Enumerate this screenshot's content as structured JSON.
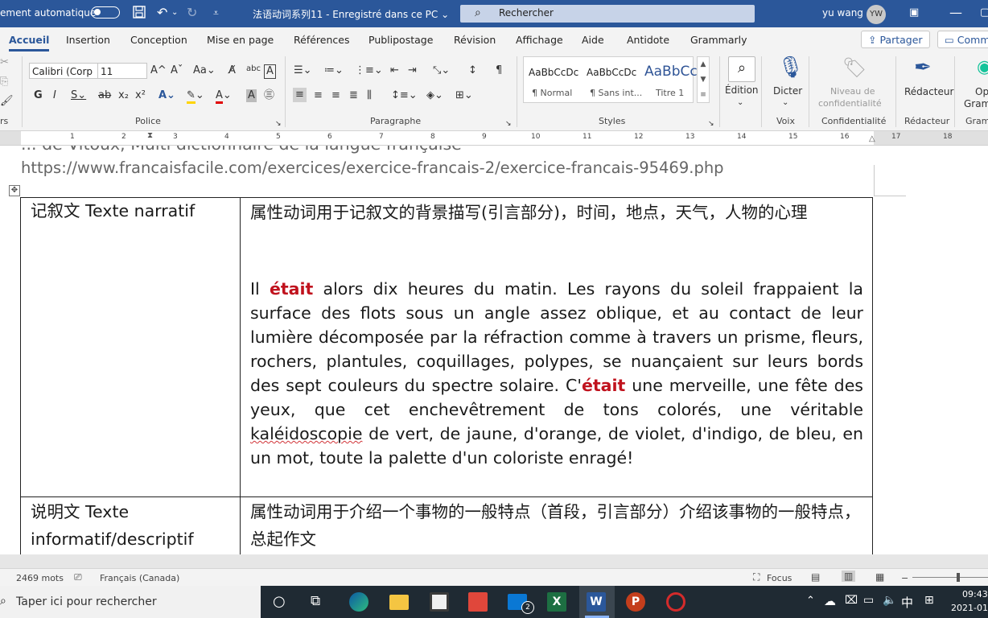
{
  "titlebar": {
    "autosave_label": "ement automatique",
    "document_title": "法语动词系列11  -  Enregistré dans ce PC  ⌄",
    "search_placeholder": "Rechercher",
    "user_name": "yu wang",
    "user_initials": "YW"
  },
  "menu": {
    "tabs": [
      "Accueil",
      "Insertion",
      "Conception",
      "Mise en page",
      "Références",
      "Publipostage",
      "Révision",
      "Affichage",
      "Aide",
      "Antidote",
      "Grammarly"
    ],
    "share_label": "Partager",
    "comments_label": "Comm"
  },
  "ribbon": {
    "font_name": "Calibri (Corp",
    "font_size": "11",
    "groups": {
      "clipboard": "rs",
      "police": "Police",
      "paragraphe": "Paragraphe",
      "styles": "Styles",
      "voix": "Voix",
      "confidentialite": "Confidentialité",
      "redacteur": "Rédacteur",
      "grammarly": "Gram"
    },
    "styles": [
      {
        "preview": "AaBbCcDc",
        "name": "¶ Normal"
      },
      {
        "preview": "AaBbCcDc",
        "name": "¶ Sans int..."
      },
      {
        "preview": "AaBbCc",
        "name": "Titre 1"
      }
    ],
    "edition_label": "Édition",
    "dicter_label": "Dicter",
    "niveau_label": "Niveau de",
    "confidentialite_label": "confidentialité",
    "redacteur_label": "Rédacteur",
    "grammarly_label_1": "Op",
    "grammarly_label_2": "Gram"
  },
  "ruler": {
    "numbers": [
      "1",
      "2",
      "3",
      "4",
      "5",
      "6",
      "7",
      "8",
      "9",
      "10",
      "11",
      "12",
      "13",
      "14",
      "15",
      "16",
      "17",
      "18"
    ]
  },
  "document": {
    "cut_line": "... de Vitoux, Multi dictionnaire de la langue française",
    "url_line": "https://www.francaisfacile.com/exercices/exercice-francais-2/exercice-francais-95469.php",
    "rows": [
      {
        "left": "记叙文 Texte narratif",
        "right_intro": "属性动词用于记叙文的背景描写(引言部分)，时间，地点，天气，人物的心理",
        "para": {
          "p1": "Il ",
          "r1": "était",
          "p2": " alors dix heures du matin. Les rayons du soleil frappaient la surface des flots sous un angle assez oblique, et au contact de leur lumière décomposée par la réfraction comme à travers un prisme, fleurs, rochers, plantules, coquillages, polypes, se nuançaient sur leurs bords des sept couleurs du spectre solaire. C'",
          "r2": "était",
          "p3": " une merveille, une fête des yeux, que cet enchevêtrement de tons colorés, une véritable ",
          "sq": "kaléidoscopie",
          "p4": " de vert, de jaune, d'orange, de violet, d'indigo, de bleu, en un mot, toute la palette d'un coloriste enragé!"
        }
      },
      {
        "left": "说明文 Texte informatif/descriptif",
        "right_intro": "属性动词用于介绍一个事物的一般特点（首段，引言部分）介绍该事物的一般特点，总起作文"
      }
    ]
  },
  "statusbar": {
    "words": "2469 mots",
    "language": "Français (Canada)",
    "focus": "Focus"
  },
  "taskbar": {
    "search_placeholder": "Taper ici pour rechercher",
    "mail_badge": "2",
    "ime": "中",
    "time": "09:43",
    "date": "2021-01-"
  },
  "colors": {
    "titlebar": "#2b579a",
    "accent": "#2b579a",
    "highlight_red": "#c0121d",
    "taskbar": "#1f2a33"
  }
}
